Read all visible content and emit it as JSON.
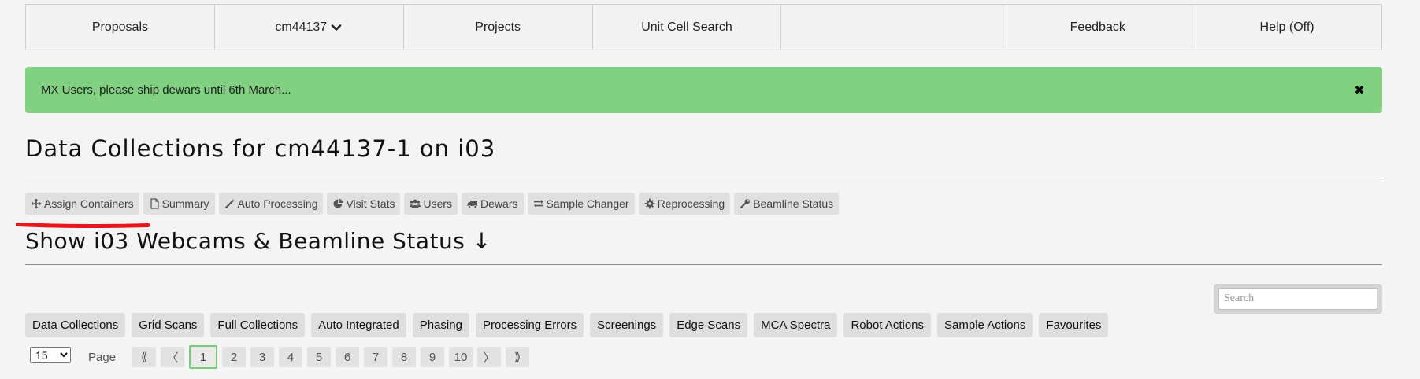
{
  "nav": {
    "proposals": "Proposals",
    "proposal_code": "cm44137",
    "projects": "Projects",
    "unit_cell_search": "Unit Cell Search",
    "feedback": "Feedback",
    "help": "Help (Off)"
  },
  "alert": {
    "message": "MX Users, please ship dewars until 6th March...",
    "close": "✖"
  },
  "page_title": "Data Collections for cm44137-1 on i03",
  "toolbar": [
    {
      "label": "Assign Containers",
      "icon": "move-arrows-icon"
    },
    {
      "label": "Summary",
      "icon": "document-icon"
    },
    {
      "label": "Auto Processing",
      "icon": "magic-wand-icon"
    },
    {
      "label": "Visit Stats",
      "icon": "pie-chart-icon"
    },
    {
      "label": "Users",
      "icon": "users-icon"
    },
    {
      "label": "Dewars",
      "icon": "truck-icon"
    },
    {
      "label": "Sample Changer",
      "icon": "exchange-arrows-icon"
    },
    {
      "label": "Reprocessing",
      "icon": "gear-icon"
    },
    {
      "label": "Beamline Status",
      "icon": "wrench-icon"
    }
  ],
  "annotation_color": "#e8151b",
  "webcams_heading": "Show i03 Webcams & Beamline Status ↓",
  "search": {
    "placeholder": "Search",
    "value": ""
  },
  "tabs": [
    "Data Collections",
    "Grid Scans",
    "Full Collections",
    "Auto Integrated",
    "Phasing",
    "Processing Errors",
    "Screenings",
    "Edge Scans",
    "MCA Spectra",
    "Robot Actions",
    "Sample Actions",
    "Favourites"
  ],
  "pagination": {
    "per_page": "15",
    "label": "Page",
    "first": "⟪",
    "prev": "〈",
    "pages": [
      "1",
      "2",
      "3",
      "4",
      "5",
      "6",
      "7",
      "8",
      "9",
      "10"
    ],
    "current": "1",
    "next": "〉",
    "last": "⟫"
  },
  "colors": {
    "alert_bg": "#82d183",
    "active_page_border": "#7dc87f",
    "button_bg": "#e0e0e0"
  }
}
